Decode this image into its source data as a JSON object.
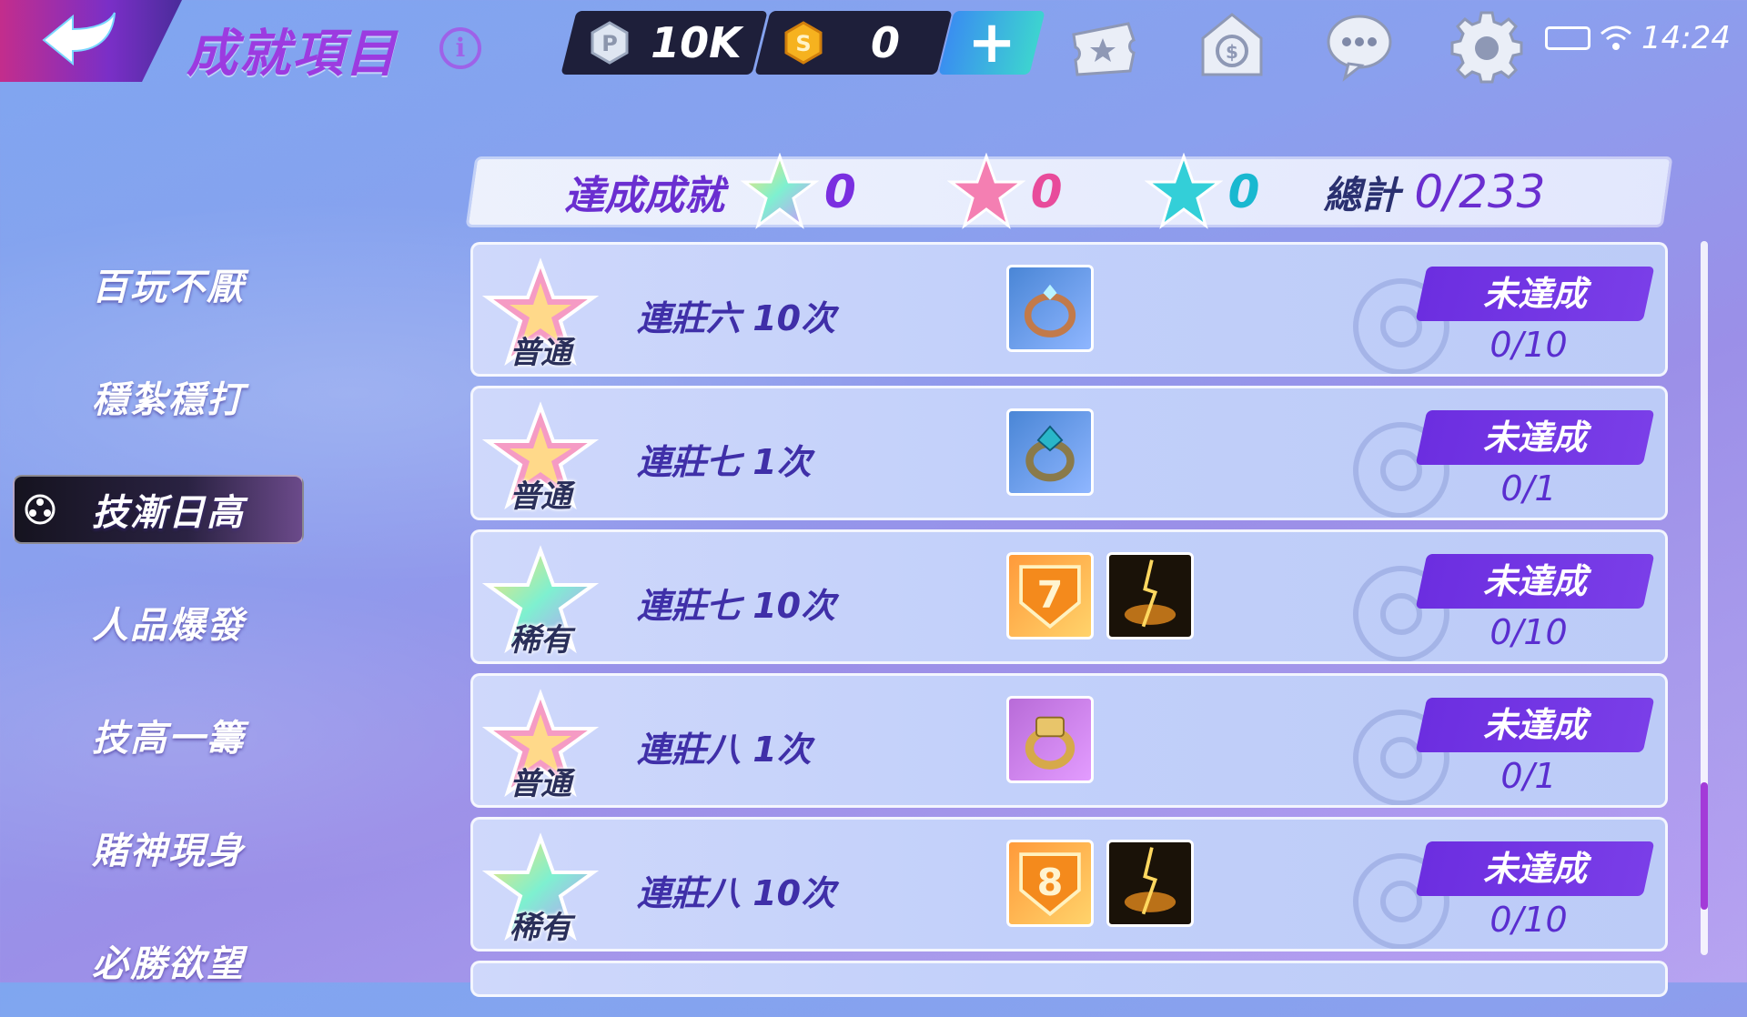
{
  "header": {
    "title": "成就項目",
    "points_value": "10K",
    "gold_value": "0",
    "clock": "14:24"
  },
  "summary": {
    "label": "達成成就",
    "rainbow_count": "0",
    "pink_count": "0",
    "cyan_count": "0",
    "total_label": "總計",
    "total_value": "0/233"
  },
  "sidebar": {
    "items": [
      {
        "label": "百玩不厭"
      },
      {
        "label": "穩紮穩打"
      },
      {
        "label": "技漸日高"
      },
      {
        "label": "人品爆發"
      },
      {
        "label": "技高一籌"
      },
      {
        "label": "賭神現身"
      },
      {
        "label": "必勝欲望"
      }
    ],
    "active_index": 2
  },
  "achievements": [
    {
      "rank": "普通",
      "name": "連莊六 10次",
      "status": "未達成",
      "progress": "0/10",
      "rewards": [
        "ring-icon"
      ]
    },
    {
      "rank": "普通",
      "name": "連莊七 1次",
      "status": "未達成",
      "progress": "0/1",
      "rewards": [
        "gem-ring-icon"
      ]
    },
    {
      "rank": "稀有",
      "name": "連莊七 10次",
      "status": "未達成",
      "progress": "0/10",
      "rewards": [
        "badge-7-icon",
        "lightning-effect-icon"
      ]
    },
    {
      "rank": "普通",
      "name": "連莊八 1次",
      "status": "未達成",
      "progress": "0/1",
      "rewards": [
        "gold-ring-icon"
      ]
    },
    {
      "rank": "稀有",
      "name": "連莊八 10次",
      "status": "未達成",
      "progress": "0/10",
      "rewards": [
        "badge-8-icon",
        "lightning-effect-icon"
      ]
    }
  ],
  "colors": {
    "accent_purple": "#6c2ee0",
    "title_purple": "#9c3be0",
    "pink_star": "#f06aa8",
    "cyan_star": "#2fd3d8"
  }
}
